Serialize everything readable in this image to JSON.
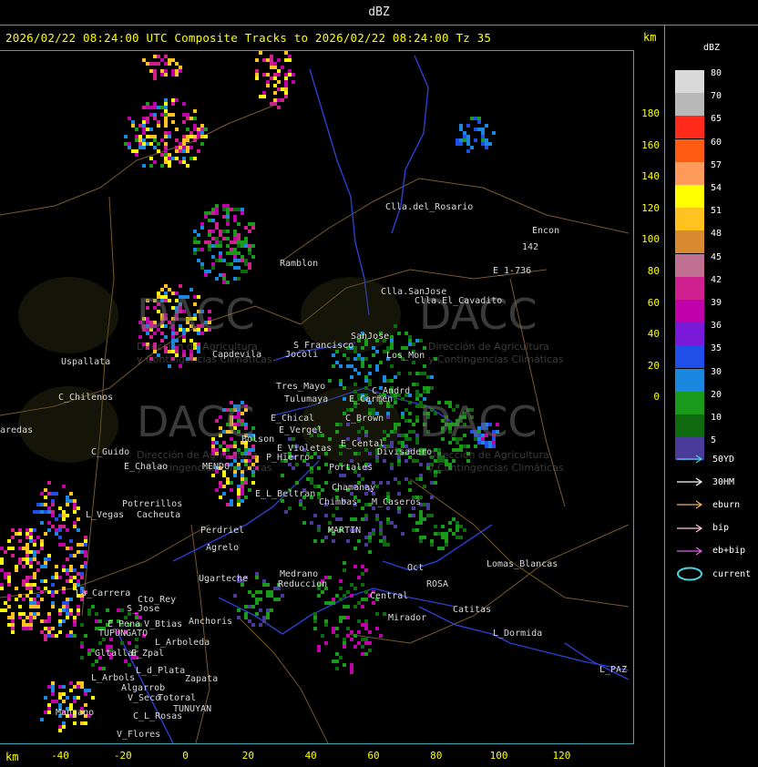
{
  "window": {
    "title": "dBZ"
  },
  "header": {
    "title": "2026/02/22 08:24:00 UTC Composite Tracks to 2026/02/22 08:24:00 Tz 35",
    "units_label": "km"
  },
  "axes": {
    "units_label": "km",
    "y_ticks": [
      "180",
      "160",
      "140",
      "120",
      "100",
      "80",
      "60",
      "40",
      "20",
      "0"
    ],
    "x_ticks": [
      "-40",
      "-20",
      "0",
      "20",
      "40",
      "60",
      "80",
      "100",
      "120"
    ]
  },
  "legend": {
    "title": "dBZ",
    "levels": [
      {
        "label": "80",
        "color": "#d9d9d9"
      },
      {
        "label": "70",
        "color": "#b8b8b8"
      },
      {
        "label": "65",
        "color": "#ff2a1a"
      },
      {
        "label": "60",
        "color": "#ff5a12"
      },
      {
        "label": "57",
        "color": "#ff9a5a"
      },
      {
        "label": "54",
        "color": "#ffff00"
      },
      {
        "label": "51",
        "color": "#ffc21e"
      },
      {
        "label": "48",
        "color": "#d98a30"
      },
      {
        "label": "45",
        "color": "#c07090"
      },
      {
        "label": "42",
        "color": "#d02090"
      },
      {
        "label": "39",
        "color": "#c000a8"
      },
      {
        "label": "36",
        "color": "#7a1ad8"
      },
      {
        "label": "35",
        "color": "#1f4fe8"
      },
      {
        "label": "30",
        "color": "#1a88e0"
      },
      {
        "label": "20",
        "color": "#1a9a1a"
      },
      {
        "label": "10",
        "color": "#0f6a0f"
      },
      {
        "label": "5",
        "color": "#4a3a9a"
      }
    ],
    "tracks": [
      {
        "label": "50YD",
        "color": "#49d6e0",
        "kind": "arrow"
      },
      {
        "label": "30HM",
        "color": "#ffffff",
        "kind": "arrow"
      },
      {
        "label": "eburn",
        "color": "#f0b060",
        "kind": "arrow"
      },
      {
        "label": "bip",
        "color": "#ffc8d8",
        "kind": "arrow"
      },
      {
        "label": "eb+bip",
        "color": "#e060e0",
        "kind": "arrow"
      },
      {
        "label": "current",
        "color": "#49d6e0",
        "kind": "ellipse"
      }
    ]
  },
  "places": [
    {
      "name": "Clla.del_Rosario"
    },
    {
      "name": "Encon"
    },
    {
      "name": "142"
    },
    {
      "name": "E_1-736"
    },
    {
      "name": "Ramblon"
    },
    {
      "name": "Clla.SanJose"
    },
    {
      "name": "Clla.El_Cavadito"
    },
    {
      "name": "Uspallata"
    },
    {
      "name": "Capdevila"
    },
    {
      "name": "S_Francisco"
    },
    {
      "name": "Jocoli"
    },
    {
      "name": "SanJose"
    },
    {
      "name": "Los_Mon"
    },
    {
      "name": "Tres_Mayo"
    },
    {
      "name": "Tulumaya"
    },
    {
      "name": "E_Carmen"
    },
    {
      "name": "C_Chilenos"
    },
    {
      "name": "C_Andrd"
    },
    {
      "name": "E_Chical"
    },
    {
      "name": "E_Vergel"
    },
    {
      "name": "C_Brown"
    },
    {
      "name": "aredas"
    },
    {
      "name": "Bolson"
    },
    {
      "name": "E_Violetas"
    },
    {
      "name": "E_Cental"
    },
    {
      "name": "Divisadero"
    },
    {
      "name": "C_Guido"
    },
    {
      "name": "E_Chalao"
    },
    {
      "name": "P_Hierro"
    },
    {
      "name": "Portales"
    },
    {
      "name": "MENDO"
    },
    {
      "name": "Chamanay"
    },
    {
      "name": "E_L_Beltran"
    },
    {
      "name": "Chimbas"
    },
    {
      "name": "M_Caseros"
    },
    {
      "name": "Potrerillos"
    },
    {
      "name": "L_Vegas"
    },
    {
      "name": "Cacheuta"
    },
    {
      "name": "Perdriel"
    },
    {
      "name": "MARTIN"
    },
    {
      "name": "Agrelo"
    },
    {
      "name": "Ugarteche"
    },
    {
      "name": "Lomas_Blancas"
    },
    {
      "name": "Reduccion"
    },
    {
      "name": "Medrano"
    },
    {
      "name": "Oct"
    },
    {
      "name": "ROSA"
    },
    {
      "name": "La_Carrera"
    },
    {
      "name": "Cto_Rey"
    },
    {
      "name": "S_Jose"
    },
    {
      "name": "Catitas"
    },
    {
      "name": "Central"
    },
    {
      "name": "Mirador"
    },
    {
      "name": "E_Pena"
    },
    {
      "name": "V_Btias"
    },
    {
      "name": "Anchoris"
    },
    {
      "name": "TUPUNGATO"
    },
    {
      "name": "L_Arboleda"
    },
    {
      "name": "L_Dormida"
    },
    {
      "name": "Gltallar"
    },
    {
      "name": "E_Zpal"
    },
    {
      "name": "L_Arbols"
    },
    {
      "name": "L_d_Plata"
    },
    {
      "name": "Zapata"
    },
    {
      "name": "L_PAZ"
    },
    {
      "name": "Algarrob"
    },
    {
      "name": "V_Seco"
    },
    {
      "name": "Totoral"
    },
    {
      "name": "TUNUYAN"
    },
    {
      "name": "Manzano"
    },
    {
      "name": "C_L_Rosas"
    },
    {
      "name": "V_Flores"
    }
  ],
  "watermark": {
    "org_name": "DACC",
    "line1": "Dirección de Agricultura",
    "line2": "y Contingencias Climáticas"
  }
}
